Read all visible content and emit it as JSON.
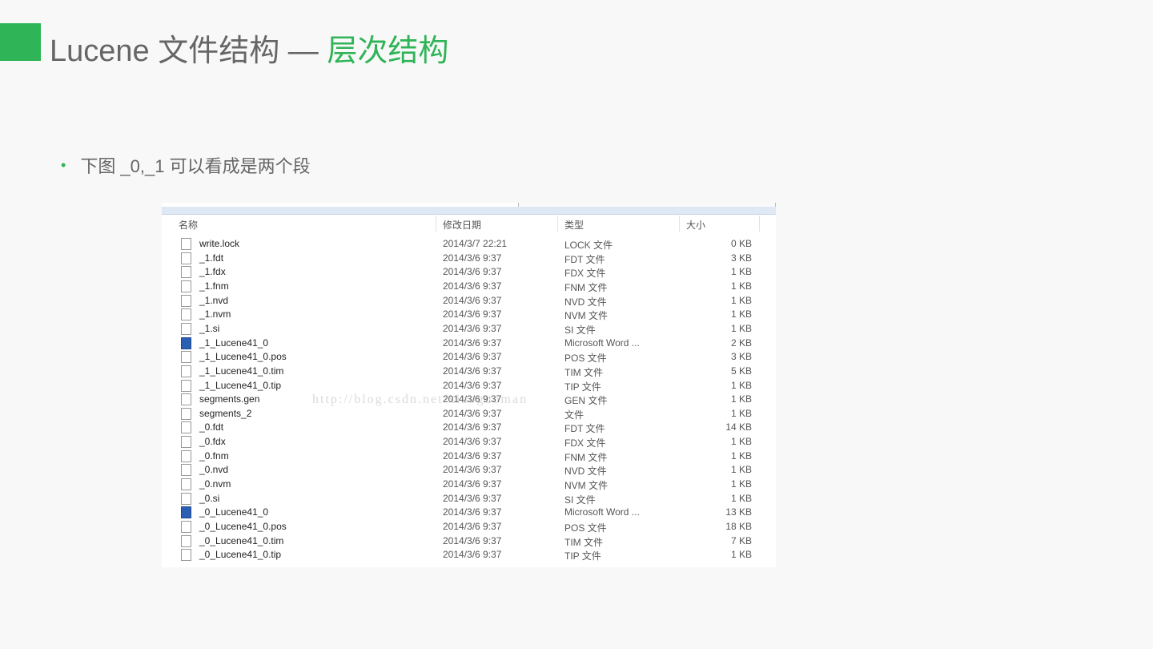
{
  "slide": {
    "title_main": "Lucene 文件结构 — ",
    "title_highlight": "层次结构",
    "bullet": "下图 _0,_1 可以看成是两个段"
  },
  "explorer": {
    "columns": {
      "name": "名称",
      "date": "修改日期",
      "type": "类型",
      "size": "大小"
    },
    "watermark": "http://blog.csdn.net/xiaoguoman",
    "files": [
      {
        "name": "write.lock",
        "date": "2014/3/7 22:21",
        "type": "LOCK 文件",
        "size": "0 KB",
        "icon": "file"
      },
      {
        "name": "_1.fdt",
        "date": "2014/3/6 9:37",
        "type": "FDT 文件",
        "size": "3 KB",
        "icon": "file"
      },
      {
        "name": "_1.fdx",
        "date": "2014/3/6 9:37",
        "type": "FDX 文件",
        "size": "1 KB",
        "icon": "file"
      },
      {
        "name": "_1.fnm",
        "date": "2014/3/6 9:37",
        "type": "FNM 文件",
        "size": "1 KB",
        "icon": "file"
      },
      {
        "name": "_1.nvd",
        "date": "2014/3/6 9:37",
        "type": "NVD 文件",
        "size": "1 KB",
        "icon": "file"
      },
      {
        "name": "_1.nvm",
        "date": "2014/3/6 9:37",
        "type": "NVM 文件",
        "size": "1 KB",
        "icon": "file"
      },
      {
        "name": "_1.si",
        "date": "2014/3/6 9:37",
        "type": "SI 文件",
        "size": "1 KB",
        "icon": "file"
      },
      {
        "name": "_1_Lucene41_0",
        "date": "2014/3/6 9:37",
        "type": "Microsoft Word ...",
        "size": "2 KB",
        "icon": "word"
      },
      {
        "name": "_1_Lucene41_0.pos",
        "date": "2014/3/6 9:37",
        "type": "POS 文件",
        "size": "3 KB",
        "icon": "file"
      },
      {
        "name": "_1_Lucene41_0.tim",
        "date": "2014/3/6 9:37",
        "type": "TIM 文件",
        "size": "5 KB",
        "icon": "file"
      },
      {
        "name": "_1_Lucene41_0.tip",
        "date": "2014/3/6 9:37",
        "type": "TIP 文件",
        "size": "1 KB",
        "icon": "file"
      },
      {
        "name": "segments.gen",
        "date": "2014/3/6 9:37",
        "type": "GEN 文件",
        "size": "1 KB",
        "icon": "file"
      },
      {
        "name": "segments_2",
        "date": "2014/3/6 9:37",
        "type": "文件",
        "size": "1 KB",
        "icon": "file"
      },
      {
        "name": "_0.fdt",
        "date": "2014/3/6 9:37",
        "type": "FDT 文件",
        "size": "14 KB",
        "icon": "file"
      },
      {
        "name": "_0.fdx",
        "date": "2014/3/6 9:37",
        "type": "FDX 文件",
        "size": "1 KB",
        "icon": "file"
      },
      {
        "name": "_0.fnm",
        "date": "2014/3/6 9:37",
        "type": "FNM 文件",
        "size": "1 KB",
        "icon": "file"
      },
      {
        "name": "_0.nvd",
        "date": "2014/3/6 9:37",
        "type": "NVD 文件",
        "size": "1 KB",
        "icon": "file"
      },
      {
        "name": "_0.nvm",
        "date": "2014/3/6 9:37",
        "type": "NVM 文件",
        "size": "1 KB",
        "icon": "file"
      },
      {
        "name": "_0.si",
        "date": "2014/3/6 9:37",
        "type": "SI 文件",
        "size": "1 KB",
        "icon": "file"
      },
      {
        "name": "_0_Lucene41_0",
        "date": "2014/3/6 9:37",
        "type": "Microsoft Word ...",
        "size": "13 KB",
        "icon": "word"
      },
      {
        "name": "_0_Lucene41_0.pos",
        "date": "2014/3/6 9:37",
        "type": "POS 文件",
        "size": "18 KB",
        "icon": "file"
      },
      {
        "name": "_0_Lucene41_0.tim",
        "date": "2014/3/6 9:37",
        "type": "TIM 文件",
        "size": "7 KB",
        "icon": "file"
      },
      {
        "name": "_0_Lucene41_0.tip",
        "date": "2014/3/6 9:37",
        "type": "TIP 文件",
        "size": "1 KB",
        "icon": "file"
      }
    ]
  }
}
